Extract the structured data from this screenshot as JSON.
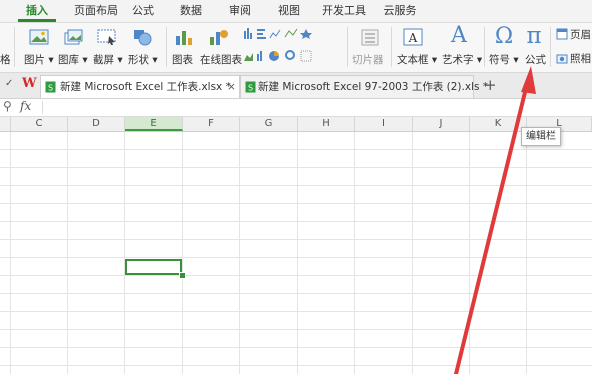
{
  "menu": {
    "items": [
      "插入",
      "页面布局",
      "公式",
      "数据",
      "审阅",
      "视图",
      "开发工具",
      "云服务"
    ],
    "active": "插入"
  },
  "ribbon": {
    "partial_left": "格",
    "buttons": [
      "图片 ▾",
      "图库 ▾",
      "截屏 ▾",
      "形状 ▾",
      "图表",
      "在线图表",
      "切片器",
      "文本框 ▾",
      "艺术字 ▾",
      "符号 ▾",
      "公式"
    ],
    "right": [
      "页眉",
      "照相"
    ],
    "formula_symbol": "π",
    "symbol_symbol": "Ω",
    "wordart_symbol": "A"
  },
  "tabs": {
    "overflow_icon": "✓",
    "wps_logo": "W",
    "doc1": "新建 Microsoft Excel 工作表.xlsx *",
    "doc2": "新建 Microsoft Excel 97-2003 工作表 (2).xls *",
    "close": "×",
    "add": "+"
  },
  "formula_bar": {
    "zoom_icon": "⚲",
    "fx": "fx",
    "value": ""
  },
  "columns": [
    "C",
    "D",
    "E",
    "F",
    "G",
    "H",
    "I",
    "J",
    "K",
    "L"
  ],
  "selected_column": "E",
  "tooltip": "编辑栏",
  "colors": {
    "accent": "#2a8a2a",
    "arrow": "#e03a3a",
    "wps_red": "#d22a2a"
  }
}
